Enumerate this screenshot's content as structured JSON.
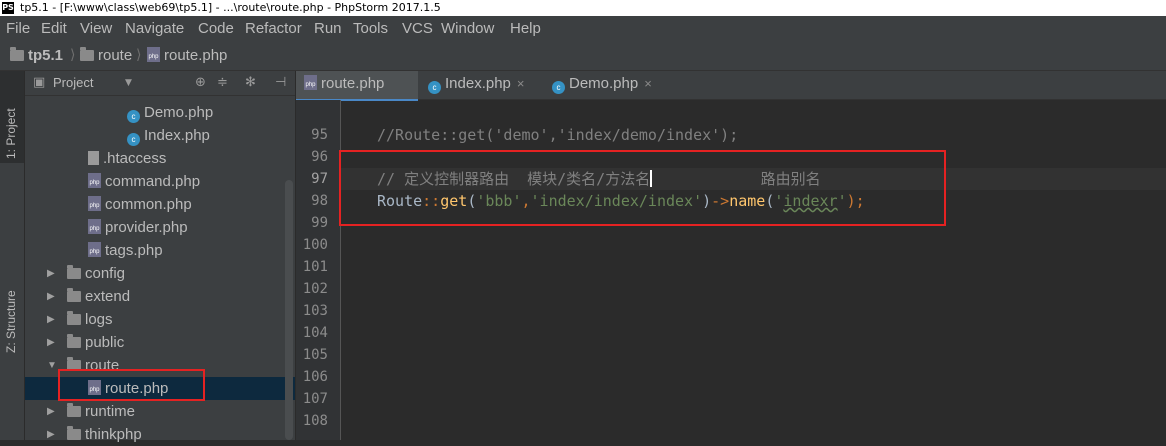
{
  "window": {
    "title": "tp5.1 - [F:\\www\\class\\web69\\tp5.1] - ...\\route\\route.php - PhpStorm 2017.1.5",
    "app_icon": "PS"
  },
  "menu": [
    "File",
    "Edit",
    "View",
    "Navigate",
    "Code",
    "Refactor",
    "Run",
    "Tools",
    "VCS",
    "Window",
    "Help"
  ],
  "breadcrumb": [
    "tp5.1",
    "route",
    "route.php"
  ],
  "left_strip": {
    "project_tab": "1: Project",
    "structure_tab": "Z: Structure"
  },
  "project_panel": {
    "title": "Project",
    "items": [
      {
        "label": "Demo.php",
        "icon": "class-icon"
      },
      {
        "label": "Index.php",
        "icon": "class-icon"
      },
      {
        "label": ".htaccess",
        "icon": "file-icon"
      },
      {
        "label": "command.php",
        "icon": "php-icon"
      },
      {
        "label": "common.php",
        "icon": "php-icon"
      },
      {
        "label": "provider.php",
        "icon": "php-icon"
      },
      {
        "label": "tags.php",
        "icon": "php-icon"
      },
      {
        "label": "config",
        "icon": "folder-icon"
      },
      {
        "label": "extend",
        "icon": "folder-icon"
      },
      {
        "label": "logs",
        "icon": "folder-icon"
      },
      {
        "label": "public",
        "icon": "folder-icon"
      },
      {
        "label": "route",
        "icon": "folder-icon"
      },
      {
        "label": "route.php",
        "icon": "php-icon",
        "selected": true
      },
      {
        "label": "runtime",
        "icon": "folder-icon"
      },
      {
        "label": "thinkphp",
        "icon": "folder-icon"
      }
    ]
  },
  "tabs": [
    {
      "label": "route.php",
      "active": true
    },
    {
      "label": "Index.php",
      "active": false
    },
    {
      "label": "Demo.php",
      "active": false
    }
  ],
  "editor": {
    "line_numbers": [
      "95",
      "96",
      "97",
      "98",
      "99",
      "100",
      "101",
      "102",
      "103",
      "104",
      "105",
      "106",
      "107",
      "108"
    ],
    "line95": "//Route::get('demo','index/demo/index');",
    "line97": "// 定义控制器路由  模块/类名/方法名",
    "line97_tail": "            路由别名",
    "line98": {
      "ident": "Route",
      "scope": "::",
      "method": "get",
      "open": "(",
      "arg1": "'bbb'",
      "comma": ",",
      "arg2": "'index/index/index'",
      "close": ")",
      "arrow": "->",
      "method2": "name",
      "open2": "(",
      "arg3_q1": "'",
      "arg3": "indexr",
      "arg3_q2": "'",
      "end": ");"
    }
  },
  "colors": {
    "annotation_box": "#e52222",
    "comment": "#808080",
    "string": "#6a8759",
    "keyword": "#cc7832"
  }
}
